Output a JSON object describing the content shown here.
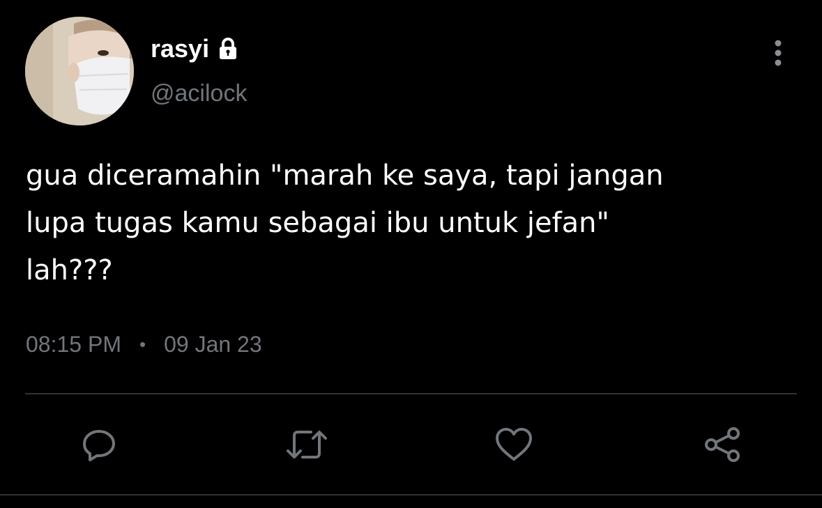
{
  "author": {
    "display_name": "rasyi",
    "handle": "@acilock",
    "protected_icon": "lock-icon",
    "avatar": "masked-person-avatar"
  },
  "tweet": {
    "text": "gua diceramahin \"marah ke saya, tapi jangan\nlupa tugas kamu sebagai ibu untuk jefan\"\nlah???",
    "time": "08:15 PM",
    "separator": "•",
    "date": "09 Jan 23"
  },
  "actions": [
    {
      "name": "reply",
      "icon": "reply-icon"
    },
    {
      "name": "retweet",
      "icon": "retweet-icon"
    },
    {
      "name": "like",
      "icon": "heart-icon"
    },
    {
      "name": "share",
      "icon": "share-icon"
    }
  ],
  "colors": {
    "background": "#000000",
    "primary_text": "#ffffff",
    "secondary_text": "#71767b",
    "divider": "#2f3336"
  }
}
